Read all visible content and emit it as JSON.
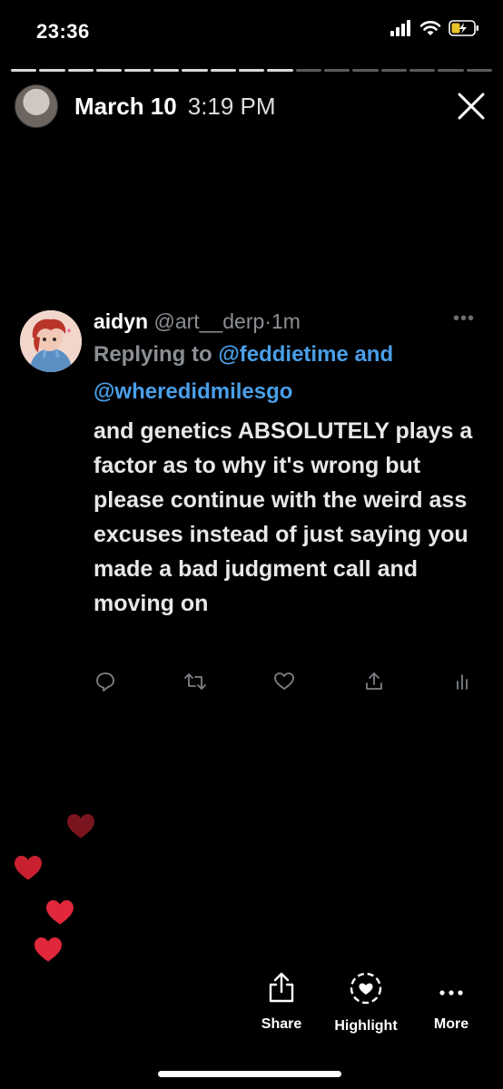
{
  "status_bar": {
    "time": "23:36",
    "icons": [
      "signal-icon",
      "wifi-icon",
      "battery-icon"
    ]
  },
  "story": {
    "segments": 17,
    "segments_done": 10,
    "date": "March 10",
    "time": "3:19 PM"
  },
  "tweet": {
    "name": "aidyn",
    "handle": "@art__derp",
    "separator": "·",
    "ago": "1m",
    "reply_prefix": "Replying to",
    "mention1": "@feddietime",
    "reply_and": "and",
    "mention2": "@wheredidmilesgo",
    "text": "and genetics ABSOLUTELY plays a factor as to why it's wrong but please continue with the weird ass excuses instead of just saying you made a bad judgment call and moving on",
    "actions": [
      "reply-icon",
      "retweet-icon",
      "like-icon",
      "share-icon",
      "analytics-icon"
    ]
  },
  "bottom_bar": {
    "share_label": "Share",
    "highlight_label": "Highlight",
    "more_label": "More"
  },
  "colors": {
    "background": "#000000",
    "mention_blue": "#4a9fe8",
    "muted_gray": "#8b8f94",
    "heart_red": "#e0283a",
    "heart_dark": "#7a1520"
  }
}
